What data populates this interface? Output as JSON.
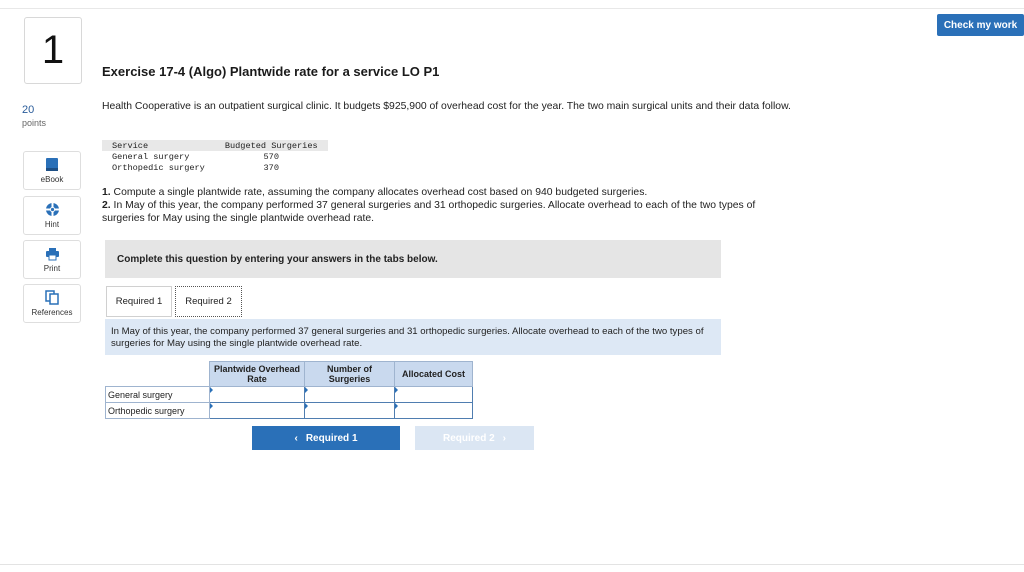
{
  "header": {
    "check_label": "Check my work"
  },
  "question": {
    "number": "1",
    "points_value": "20",
    "points_label": "points"
  },
  "sidebar": {
    "tools": [
      {
        "label": "eBook",
        "icon": "book-icon"
      },
      {
        "label": "Hint",
        "icon": "hint-icon"
      },
      {
        "label": "Print",
        "icon": "print-icon"
      },
      {
        "label": "References",
        "icon": "references-icon"
      }
    ]
  },
  "exercise": {
    "title": "Exercise 17-4 (Algo) Plantwide rate for a service LO P1",
    "intro": "Health Cooperative is an outpatient surgical clinic. It budgets $925,900 of overhead cost for the year. The two main surgical units and their data follow.",
    "data_table": {
      "headers": [
        "Service",
        "Budgeted Surgeries"
      ],
      "rows": [
        [
          "General surgery",
          "570"
        ],
        [
          "Orthopedic surgery",
          "370"
        ]
      ]
    },
    "instr1_num": "1.",
    "instr1": " Compute a single plantwide rate, assuming the company allocates overhead cost based on 940 budgeted surgeries.",
    "instr2_num": "2.",
    "instr2": " In May of this year, the company performed 37 general surgeries and 31 orthopedic surgeries. Allocate overhead to each of the two types of surgeries for May using the single plantwide overhead rate."
  },
  "complete_text": "Complete this question by entering your answers in the tabs below.",
  "tabs": [
    "Required 1",
    "Required 2"
  ],
  "required_text": "In May of this year, the company performed 37 general surgeries and 31 orthopedic surgeries. Allocate overhead to each of the two types of surgeries for May using the single plantwide overhead rate.",
  "answer_table": {
    "headers": [
      "Plantwide Overhead Rate",
      "Number of Surgeries",
      "Allocated Cost"
    ],
    "rows": [
      "General surgery",
      "Orthopedic surgery"
    ]
  },
  "nav": {
    "prev_label": "Required 1",
    "next_label": "Required 2"
  },
  "colors": {
    "accent": "#2a70b8",
    "tab_panel": "#dde8f5",
    "table_header": "#c9d9ee"
  }
}
